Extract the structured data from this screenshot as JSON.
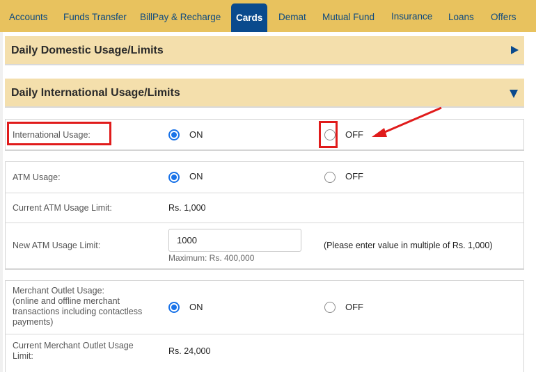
{
  "nav": {
    "items": [
      {
        "label": "Accounts"
      },
      {
        "label": "Funds Transfer"
      },
      {
        "label": "BillPay & Recharge"
      },
      {
        "label": "Cards",
        "active": true
      },
      {
        "label": "Demat"
      },
      {
        "label": "Mutual Fund"
      },
      {
        "label": "Insurance"
      },
      {
        "label": "Loans"
      },
      {
        "label": "Offers"
      }
    ]
  },
  "sections": {
    "domestic": {
      "title": "Daily Domestic Usage/Limits",
      "state": "collapsed",
      "icon": "triangle-right-icon"
    },
    "international": {
      "title": "Daily International Usage/Limits",
      "state": "expanded",
      "icon": "triangle-down-icon"
    }
  },
  "international_usage": {
    "label": "International Usage:",
    "on_label": "ON",
    "off_label": "OFF",
    "selected": "ON"
  },
  "atm": {
    "usage_label": "ATM Usage:",
    "on_label": "ON",
    "off_label": "OFF",
    "selected": "ON",
    "current_limit_label": "Current ATM Usage Limit:",
    "current_limit_value": "Rs. 1,000",
    "new_limit_label": "New ATM Usage Limit:",
    "new_limit_input_value": "1000",
    "new_limit_max": "Maximum: Rs. 400,000",
    "new_limit_note": "(Please enter value in multiple of Rs. 1,000)"
  },
  "merchant": {
    "usage_label_line1": "Merchant Outlet Usage:",
    "usage_label_line2": "(online and offline merchant",
    "usage_label_line3": "transactions including contactless",
    "usage_label_line4": "payments)",
    "on_label": "ON",
    "off_label": "OFF",
    "selected": "ON",
    "current_limit_label_line1": "Current Merchant Outlet Usage",
    "current_limit_label_line2": "Limit:",
    "current_limit_value": "Rs. 24,000"
  },
  "annotations": {
    "highlight_color": "#e01b1b"
  }
}
